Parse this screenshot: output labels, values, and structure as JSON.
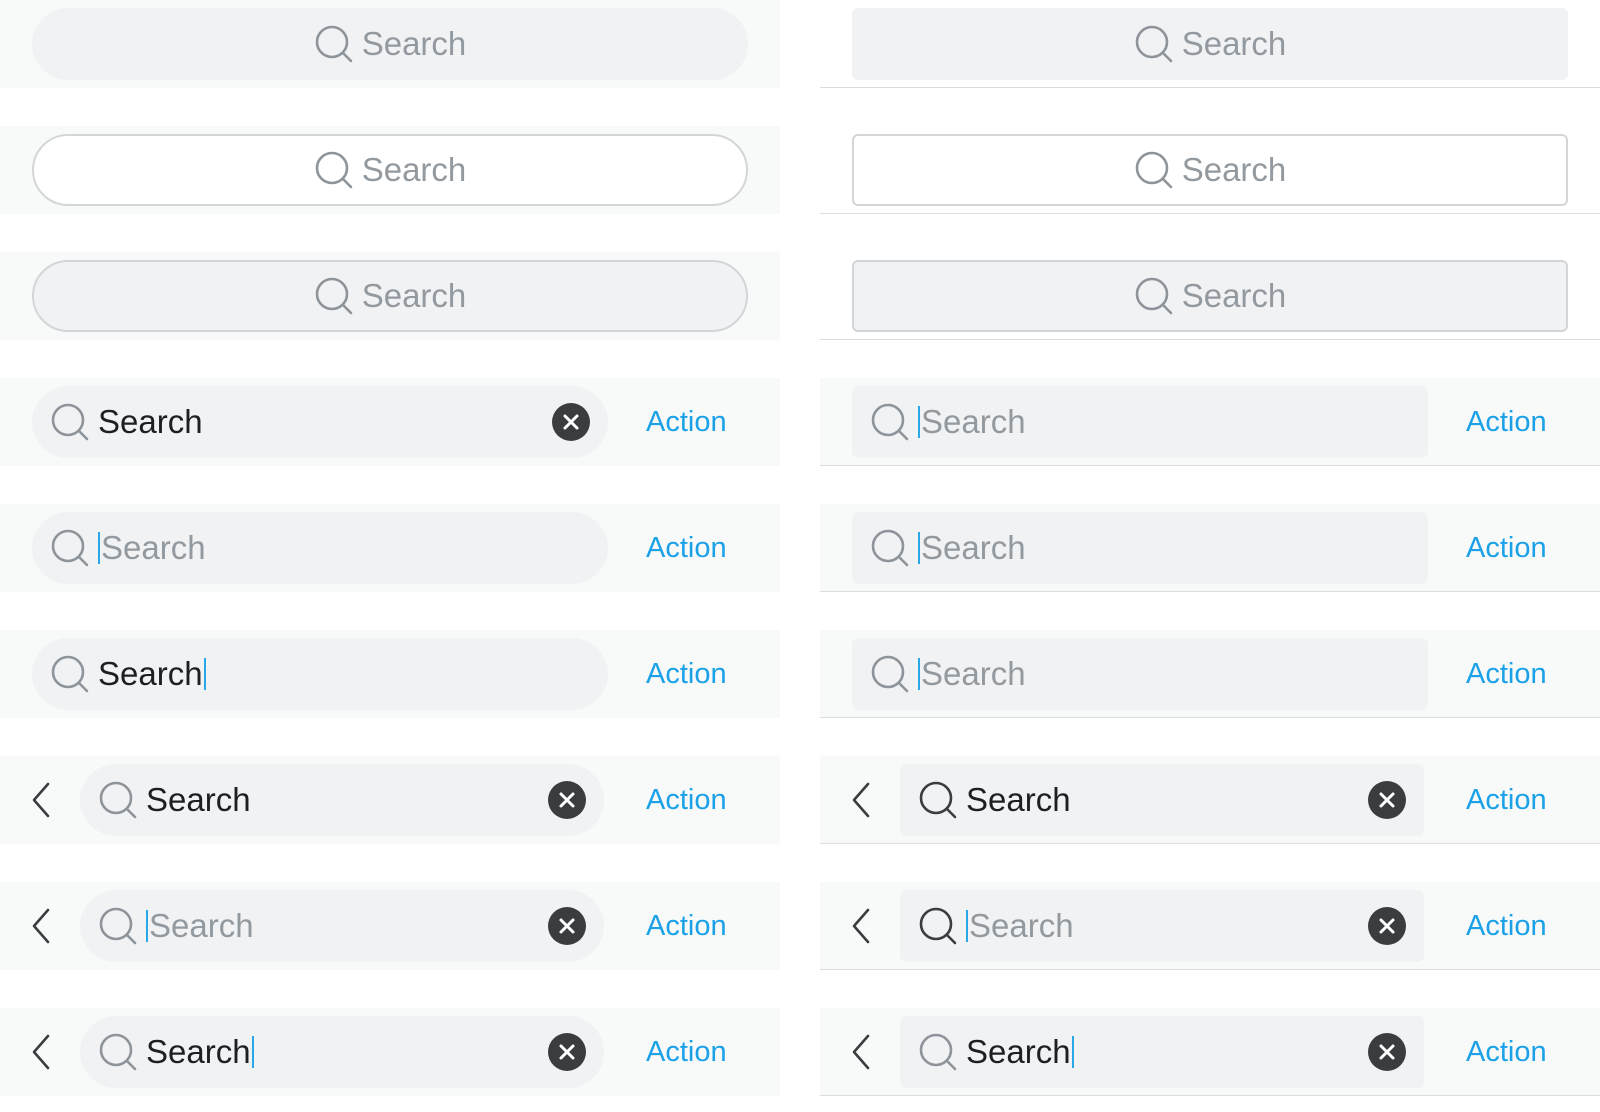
{
  "search": {
    "placeholder": "Search",
    "value": "Search"
  },
  "action_label": "Action",
  "colors": {
    "accent": "#1ba1e8",
    "row_background": "#f8f9f9",
    "field_background": "#f1f2f4",
    "placeholder": "#939a9f",
    "text": "#1d1f21",
    "clear_button": "#3a3d40",
    "caret": "#2aa7e6"
  },
  "icons": [
    "search-icon",
    "clear-icon",
    "back-chevron-icon"
  ]
}
